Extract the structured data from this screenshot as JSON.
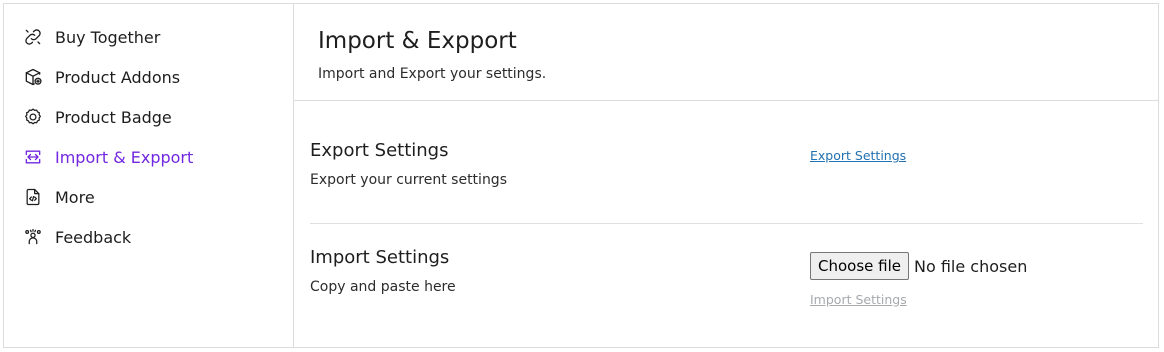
{
  "sidebar": {
    "items": [
      {
        "label": "Buy Together",
        "icon": "link-icon",
        "active": false
      },
      {
        "label": "Product Addons",
        "icon": "box-plus-icon",
        "active": false
      },
      {
        "label": "Product Badge",
        "icon": "badge-icon",
        "active": false
      },
      {
        "label": "Import & Expport",
        "icon": "import-export-icon",
        "active": true
      },
      {
        "label": "More",
        "icon": "code-file-icon",
        "active": false
      },
      {
        "label": "Feedback",
        "icon": "feedback-icon",
        "active": false
      }
    ],
    "active_color": "#7227e0"
  },
  "header": {
    "title": "Import & Expport",
    "subtitle": "Import and Export your settings."
  },
  "export_section": {
    "title": "Export Settings",
    "description": "Export your current settings",
    "button_label": "Export Settings",
    "link_color": "#2271b1"
  },
  "import_section": {
    "title": "Import Settings",
    "description": "Copy and paste here",
    "choose_file_label": "Choose file",
    "file_status": "No file chosen",
    "button_label": "Import Settings",
    "disabled_color": "#a7aaad"
  }
}
